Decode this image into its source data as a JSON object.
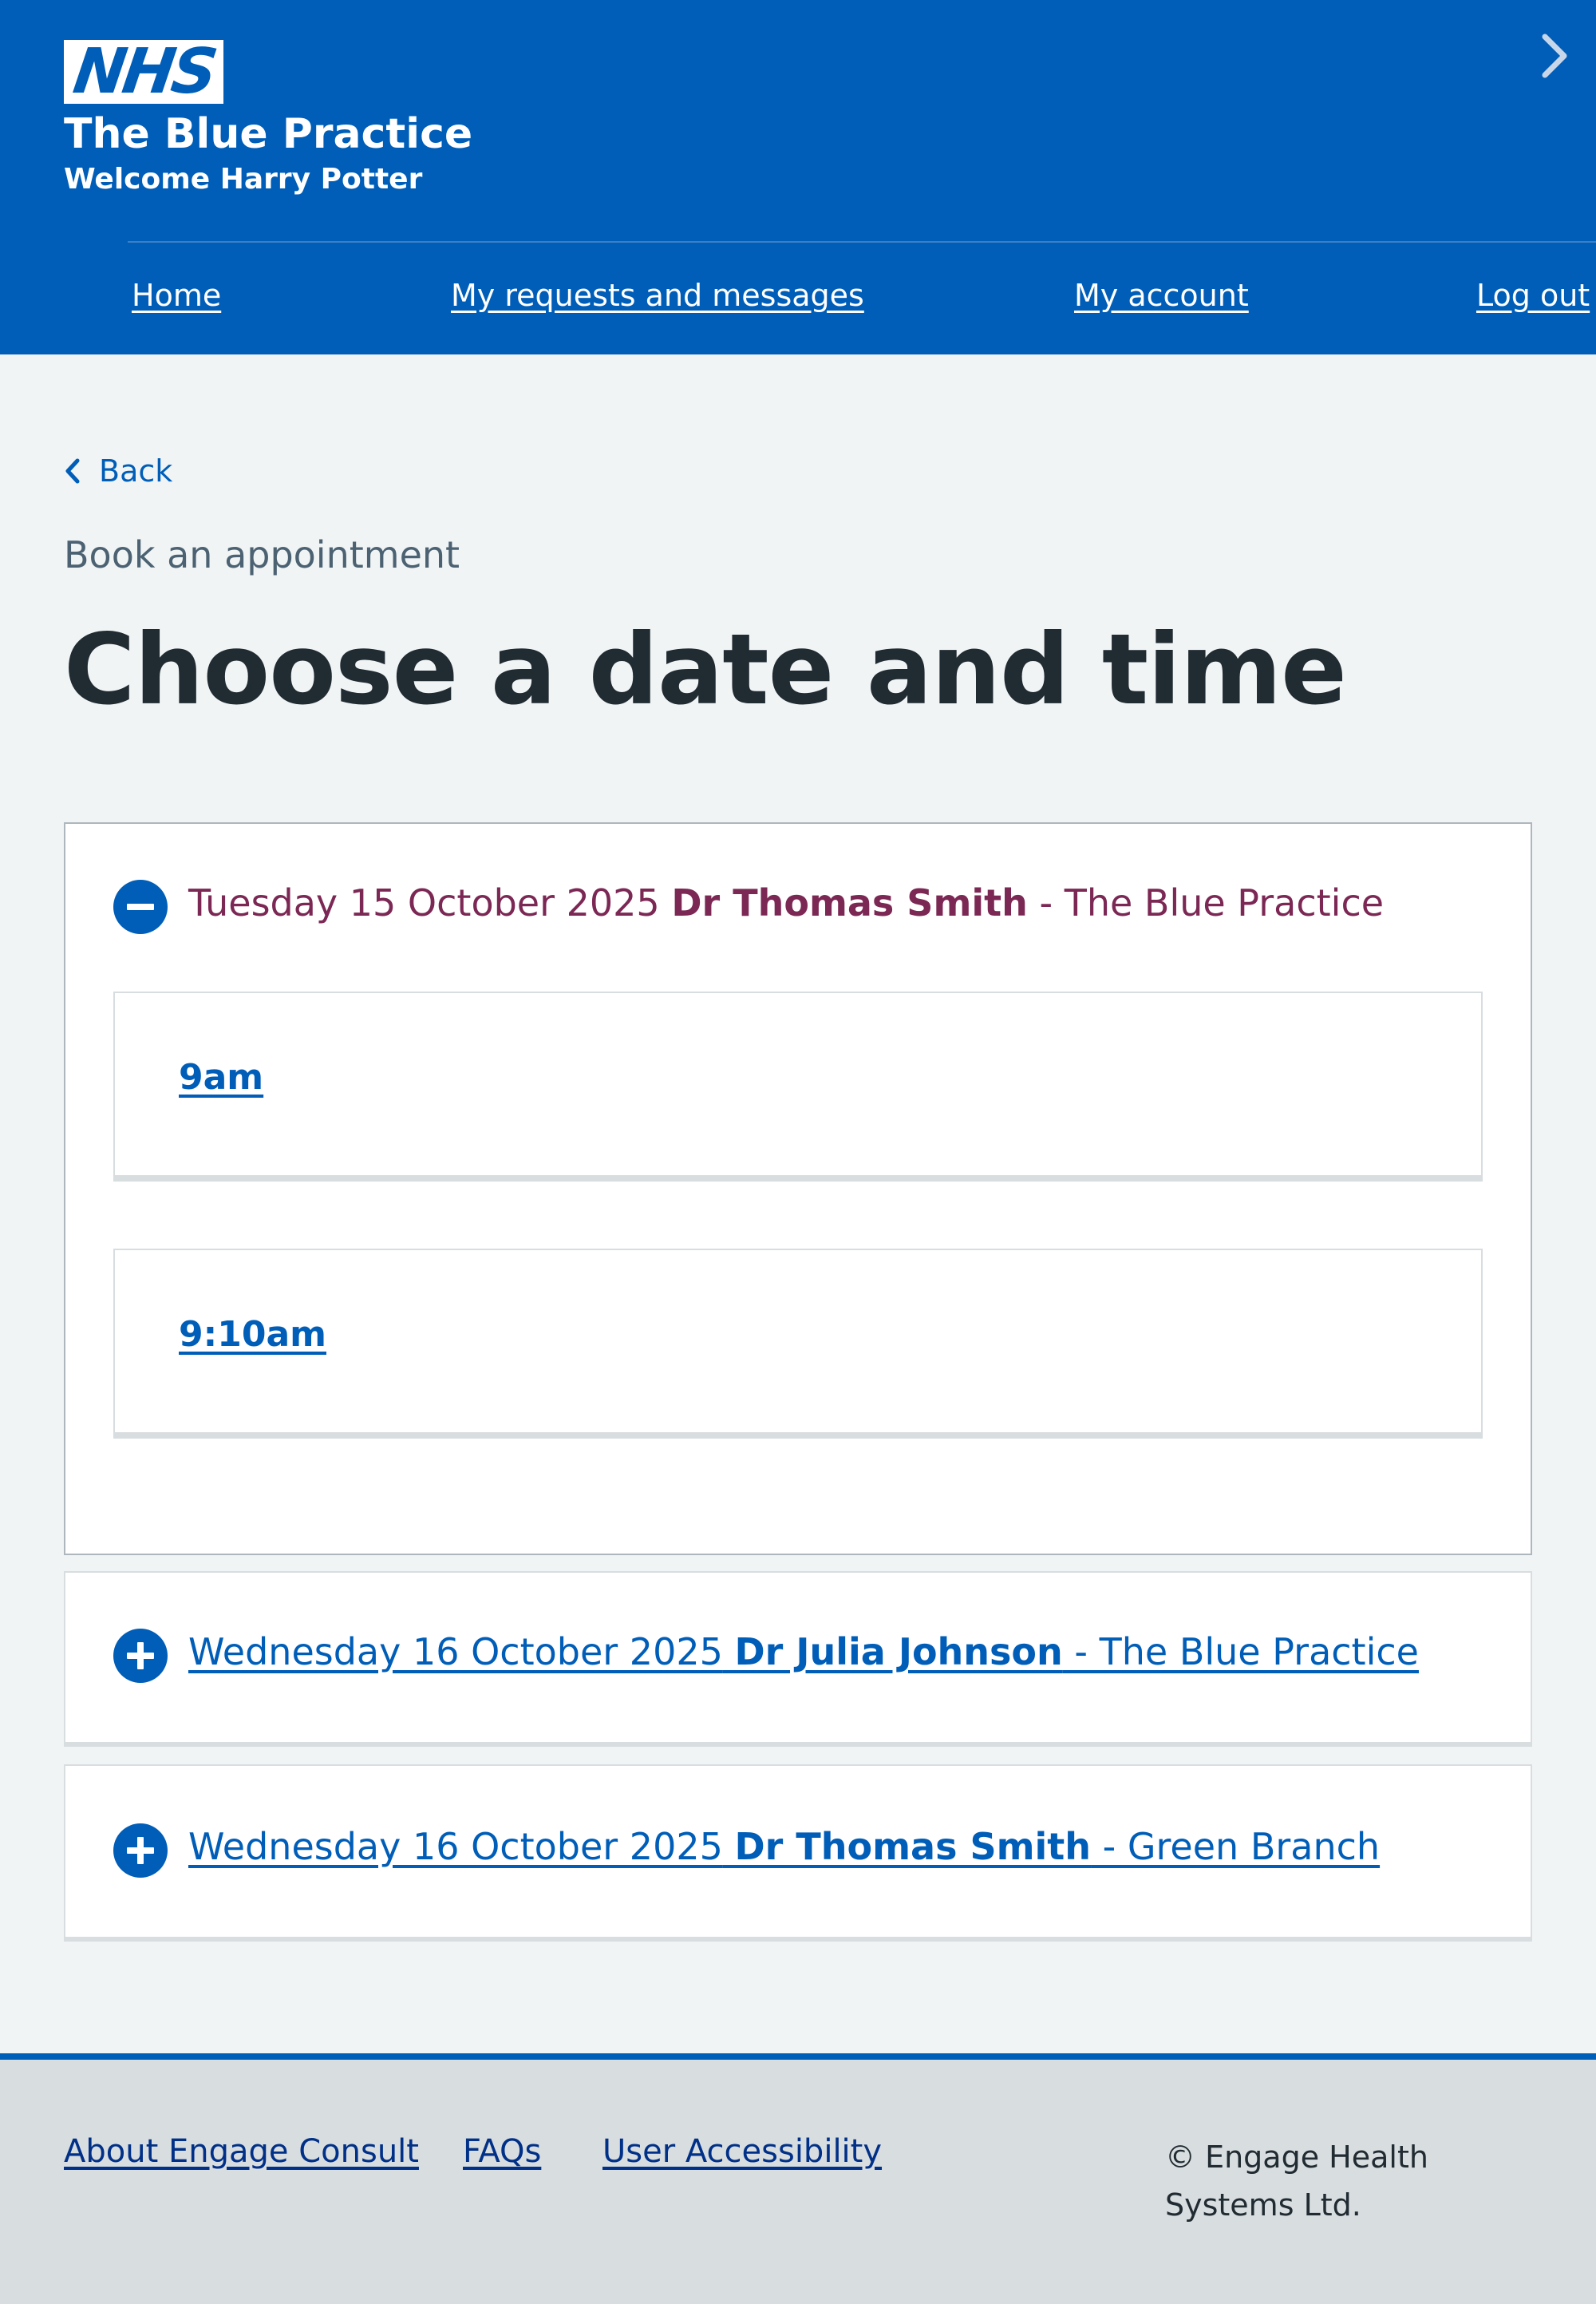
{
  "header": {
    "logo_text": "NHS",
    "org_name": "The Blue Practice",
    "welcome": "Welcome Harry Potter",
    "nav": [
      {
        "label": "Home"
      },
      {
        "label": "My requests and messages"
      },
      {
        "label": "My account"
      },
      {
        "label": "Log out"
      }
    ]
  },
  "main": {
    "back_label": "Back",
    "caption": "Book an appointment",
    "title": "Choose a date and time",
    "appointments": [
      {
        "date": "Tuesday 15 October 2025",
        "doctor": "Dr Thomas Smith",
        "location": " - The Blue Practice",
        "expanded": true,
        "slots": [
          "9am",
          "9:10am"
        ]
      },
      {
        "date": "Wednesday 16 October 2025",
        "doctor": "Dr Julia Johnson",
        "location": " - The Blue Practice",
        "expanded": false
      },
      {
        "date": "Wednesday 16 October 2025",
        "doctor": "Dr Thomas Smith",
        "location": " - Green Branch",
        "expanded": false
      }
    ]
  },
  "footer": {
    "links": [
      {
        "label": "About Engage Consult"
      },
      {
        "label": "FAQs"
      },
      {
        "label": "User Accessibility"
      }
    ],
    "copyright": "© Engage Health Systems Ltd."
  },
  "colors": {
    "brand_blue": "#005eb8",
    "open_heading": "#7c2855",
    "background": "#f0f4f5",
    "footer_bg": "#d8dde0"
  }
}
